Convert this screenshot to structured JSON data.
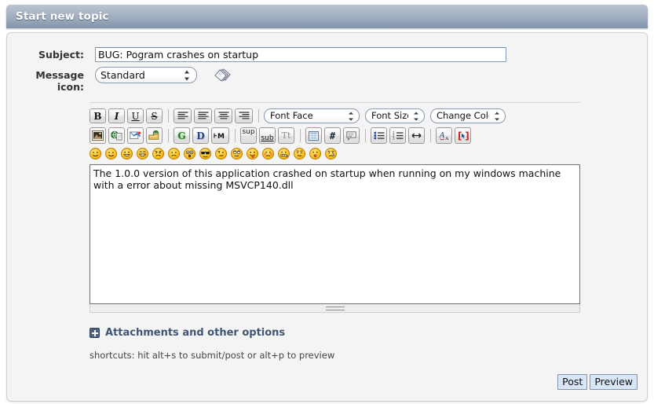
{
  "window": {
    "title": "Start new topic"
  },
  "form": {
    "subject_label": "Subject:",
    "subject_value": "BUG: Pogram crashes on startup",
    "subject_placeholder": "",
    "message_icon_label": "Message icon:",
    "message_icon_value": "Standard",
    "message_icon_options": [
      "Standard"
    ]
  },
  "toolbar": {
    "row1": [
      {
        "name": "bold-icon",
        "label": "B",
        "title": "Bold"
      },
      {
        "name": "italic-icon",
        "label": "I",
        "title": "Italic"
      },
      {
        "name": "underline-icon",
        "label": "U",
        "title": "Underline"
      },
      {
        "name": "strikethrough-icon",
        "label": "S",
        "title": "Strikethrough"
      },
      {
        "name": "align-left-icon",
        "label": "",
        "title": "Align Left"
      },
      {
        "name": "align-center-icon",
        "label": "",
        "title": "Centered"
      },
      {
        "name": "align-justify-icon",
        "label": "",
        "title": "Justify"
      },
      {
        "name": "align-right-icon",
        "label": "",
        "title": "Align Right"
      }
    ],
    "font_face": "Font Face",
    "font_size": "Font Size",
    "change_color": "Change Color",
    "row2": [
      {
        "name": "insert-image-icon",
        "title": "Insert Image"
      },
      {
        "name": "insert-hyperlink-icon",
        "title": "Insert Hyperlink"
      },
      {
        "name": "insert-email-icon",
        "title": "Insert Email"
      },
      {
        "name": "insert-ftp-link-icon",
        "title": "Insert FTP Link"
      },
      {
        "name": "glow-icon",
        "label": "G",
        "title": "Glow"
      },
      {
        "name": "shadow-icon",
        "label": "D",
        "title": "Shadow"
      },
      {
        "name": "marquee-icon",
        "label": "M",
        "title": "Marquee"
      },
      {
        "name": "superscript-icon",
        "label": "sup",
        "title": "Superscript"
      },
      {
        "name": "subscript-icon",
        "label": "sub",
        "title": "Subscript"
      },
      {
        "name": "teletype-icon",
        "label": "Tt",
        "title": "Teletype"
      },
      {
        "name": "insert-table-icon",
        "title": "Insert Table"
      },
      {
        "name": "insert-code-icon",
        "label": "#",
        "title": "Insert Code"
      },
      {
        "name": "insert-quote-icon",
        "title": "Insert Quote"
      },
      {
        "name": "bulleted-list-icon",
        "title": "Bulleted List"
      },
      {
        "name": "numbered-list-icon",
        "title": "Numbered List"
      },
      {
        "name": "horizontal-rule-icon",
        "title": "Horizontal Rule"
      },
      {
        "name": "toggle-view-icon",
        "title": "Toggle View"
      },
      {
        "name": "insert-bbcode-icon",
        "title": "Insert BBCode"
      }
    ],
    "smileys": [
      {
        "name": "smiley-smile-icon",
        "title": "Smiley"
      },
      {
        "name": "smiley-wink-icon",
        "title": "Wink"
      },
      {
        "name": "smiley-cheesy-icon",
        "title": "Cheesy"
      },
      {
        "name": "smiley-grin-icon",
        "title": "Grin"
      },
      {
        "name": "smiley-angry-icon",
        "title": "Angry"
      },
      {
        "name": "smiley-sad-icon",
        "title": "Sad"
      },
      {
        "name": "smiley-shocked-icon",
        "title": "Shocked"
      },
      {
        "name": "smiley-cool-icon",
        "title": "Cool"
      },
      {
        "name": "smiley-huh-icon",
        "title": "Huh"
      },
      {
        "name": "smiley-rolleyes-icon",
        "title": "Roll Eyes"
      },
      {
        "name": "smiley-tongue-icon",
        "title": "Tongue"
      },
      {
        "name": "smiley-embarrassed-icon",
        "title": "Embarrassed"
      },
      {
        "name": "smiley-lips-sealed-icon",
        "title": "Lips Sealed"
      },
      {
        "name": "smiley-undecided-icon",
        "title": "Undecided"
      },
      {
        "name": "smiley-kiss-icon",
        "title": "Kiss"
      },
      {
        "name": "smiley-cry-icon",
        "title": "Cry"
      }
    ]
  },
  "message": {
    "body": "The 1.0.0 version of this application crashed on startup when running on my windows machine with a error about missing MSVCP140.dll",
    "placeholder": ""
  },
  "attachments": {
    "label": "Attachments and other options"
  },
  "shortcuts": {
    "text": "shortcuts: hit alt+s to submit/post or alt+p to preview"
  },
  "actions": {
    "post_label": "Post",
    "preview_label": "Preview"
  },
  "colors": {
    "titlebar_top": "#b9c3d1",
    "titlebar_bottom": "#8094ab",
    "panel_bg": "#f4f4f4",
    "panel_border": "#cfcfcf",
    "attach_link": "#3f5573",
    "button_bg": "#d9e6f7",
    "input_border": "#7f9db9"
  }
}
